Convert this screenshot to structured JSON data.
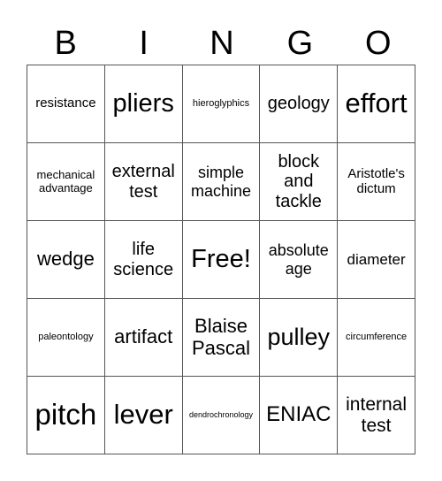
{
  "header": {
    "letters": [
      "B",
      "I",
      "N",
      "G",
      "O"
    ]
  },
  "card": {
    "rows": [
      [
        "resistance",
        "pliers",
        "hieroglyphics",
        "geology",
        "effort"
      ],
      [
        "mechanical advantage",
        "external test",
        "simple machine",
        "block and tackle",
        "Aristotle's dictum"
      ],
      [
        "wedge",
        "life science",
        "Free!",
        "absolute age",
        "diameter"
      ],
      [
        "paleontology",
        "artifact",
        "Blaise Pascal",
        "pulley",
        "circumference"
      ],
      [
        "pitch",
        "lever",
        "dendrochronology",
        "ENIAC",
        "internal test"
      ]
    ]
  }
}
